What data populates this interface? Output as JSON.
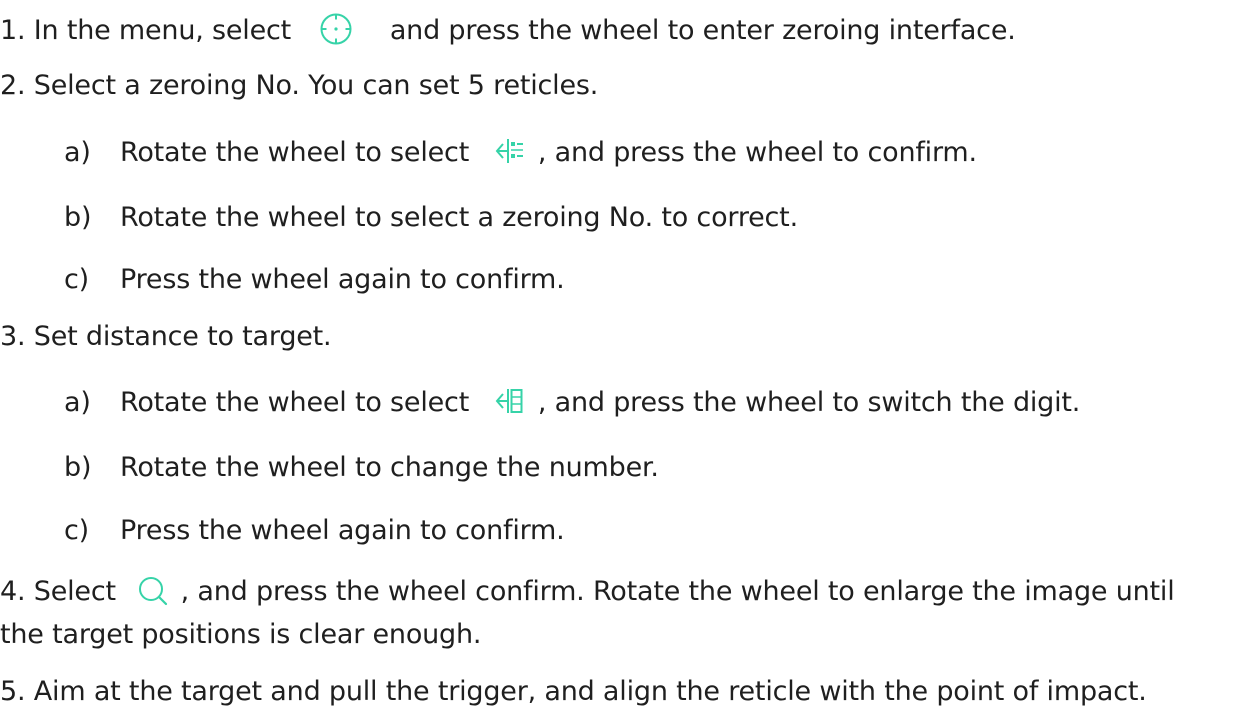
{
  "steps": [
    {
      "number": "1.",
      "before": "In the menu, select",
      "icon": "crosshair-icon",
      "after": "and press the wheel to enter zeroing interface."
    },
    {
      "number": "2.",
      "text": "Select a zeroing No. You can set 5 reticles.",
      "substeps": [
        {
          "marker": "a)",
          "before": "Rotate the wheel to select",
          "icon": "zeroing-list-icon",
          "after": ", and press the wheel to confirm."
        },
        {
          "marker": "b)",
          "text": "Rotate the wheel to select a zeroing No. to correct."
        },
        {
          "marker": "c)",
          "text": "Press the wheel again to confirm."
        }
      ]
    },
    {
      "number": "3.",
      "text": "Set distance to target.",
      "substeps": [
        {
          "marker": "a)",
          "before": "Rotate the wheel to select",
          "icon": "distance-digit-icon",
          "after": ", and press the wheel to switch the digit."
        },
        {
          "marker": "b)",
          "text": "Rotate the wheel to change the number."
        },
        {
          "marker": "c)",
          "text": "Press the wheel again to confirm."
        }
      ]
    },
    {
      "number": "4.",
      "before": "Select",
      "icon": "zoom-magnifier-icon",
      "after": ", and press the wheel confirm. Rotate the wheel to enlarge the image until",
      "continuation": "the target positions is clear enough."
    },
    {
      "number": "5.",
      "text": "Aim at the target and pull the trigger, and align the reticle with the point of impact."
    }
  ],
  "accent_color": "#36d3a8"
}
